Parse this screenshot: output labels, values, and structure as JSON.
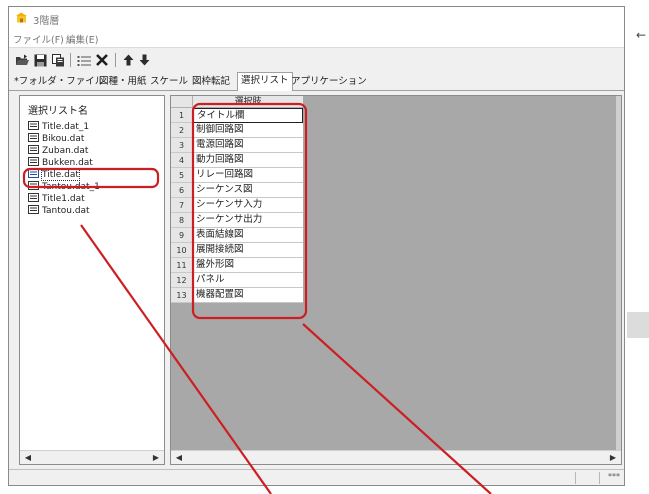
{
  "window": {
    "title": "3階層"
  },
  "menu": [
    {
      "label": "ファイル(F)"
    },
    {
      "label": "編集(E)"
    }
  ],
  "toolbar": {
    "icons": [
      "open-folder-icon",
      "save-icon",
      "copy-icon",
      "list-icon",
      "delete-icon",
      "move-up-icon",
      "move-down-icon"
    ]
  },
  "tabs": [
    {
      "label": "*フォルダ・ファイル"
    },
    {
      "label": "図種・用紙"
    },
    {
      "label": "スケール"
    },
    {
      "label": "図枠転記"
    },
    {
      "label": "選択リスト",
      "active": true
    },
    {
      "label": "アプリケーション"
    }
  ],
  "left_panel": {
    "header": "選択リスト名",
    "items": [
      {
        "label": "Title.dat_1"
      },
      {
        "label": "Bikou.dat"
      },
      {
        "label": "Zuban.dat"
      },
      {
        "label": "Bukken.dat"
      },
      {
        "label": "Title.dat",
        "selected": true
      },
      {
        "label": "Tantou.dat_1"
      },
      {
        "label": "Title1.dat"
      },
      {
        "label": "Tantou.dat"
      }
    ]
  },
  "grid": {
    "column_header": "選択肢",
    "rows": [
      {
        "num": "1",
        "value": "タイトル欄"
      },
      {
        "num": "2",
        "value": "制御回路図"
      },
      {
        "num": "3",
        "value": "電源回路図"
      },
      {
        "num": "4",
        "value": "動力回路図"
      },
      {
        "num": "5",
        "value": "リレー回路図"
      },
      {
        "num": "6",
        "value": "シーケンス図"
      },
      {
        "num": "7",
        "value": "シーケンサ入力"
      },
      {
        "num": "8",
        "value": "シーケンサ出力"
      },
      {
        "num": "9",
        "value": "表面結線図"
      },
      {
        "num": "10",
        "value": "展開接続図"
      },
      {
        "num": "11",
        "value": "盤外形図"
      },
      {
        "num": "12",
        "value": "パネル"
      },
      {
        "num": "13",
        "value": "機器配置図"
      }
    ]
  },
  "statusbar": {
    "right_text": "***"
  },
  "colors": {
    "annotation_red": "#cc1f24",
    "panel_gray": "#a8a8a8"
  }
}
